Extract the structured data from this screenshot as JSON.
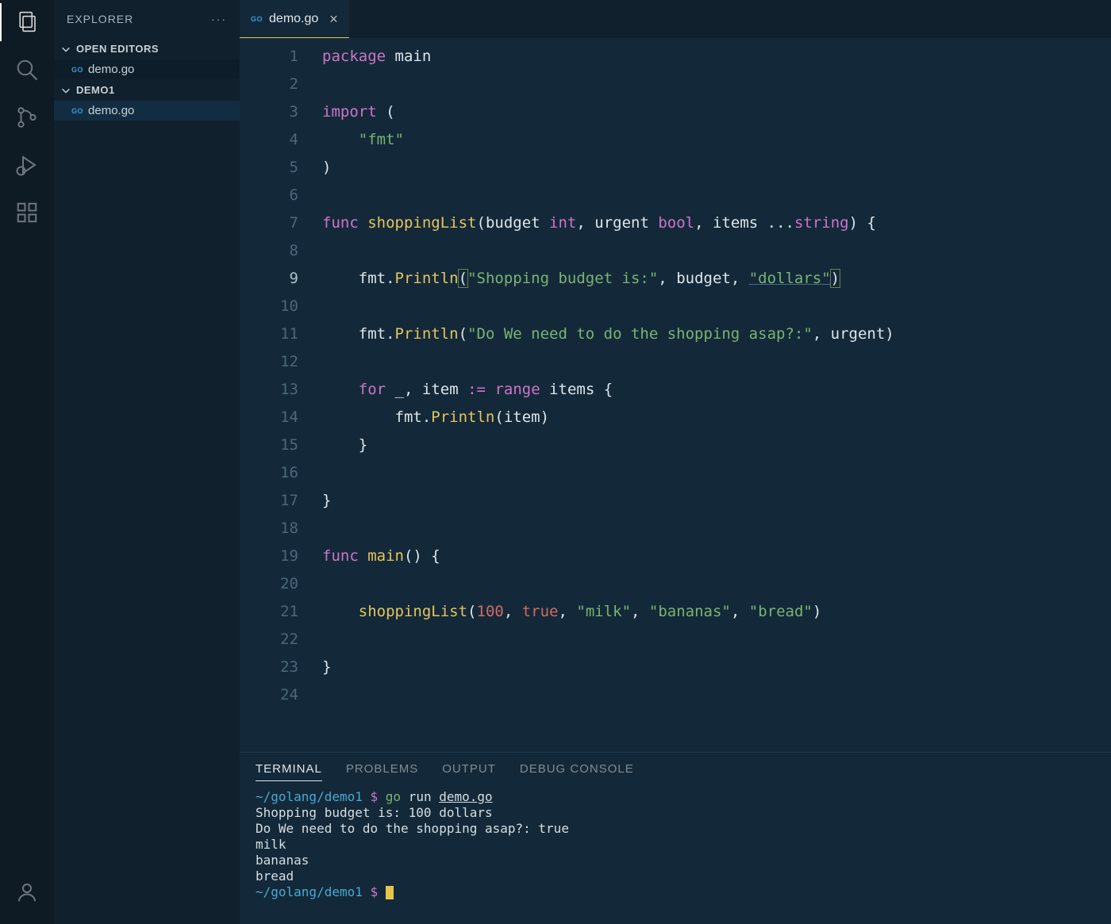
{
  "sidebar": {
    "title": "EXPLORER",
    "sections": {
      "open_editors_label": "OPEN EDITORS",
      "open_editors_file": "demo.go",
      "folder_label": "DEMO1",
      "folder_file": "demo.go"
    }
  },
  "tab": {
    "label": "demo.go"
  },
  "editor": {
    "lines": [
      1,
      2,
      3,
      4,
      5,
      6,
      7,
      8,
      9,
      10,
      11,
      12,
      13,
      14,
      15,
      16,
      17,
      18,
      19,
      20,
      21,
      22,
      23,
      24
    ],
    "active_line": 9
  },
  "code": {
    "l1_package": "package",
    "l1_main": "main",
    "l3_import": "import",
    "l4_fmt": "\"fmt\"",
    "l7_func": "func",
    "l7_name": "shoppingList",
    "l7_p1": "budget",
    "l7_t1": "int",
    "l7_p2": "urgent",
    "l7_t2": "bool",
    "l7_p3": "items",
    "l7_t3": "string",
    "l9_fmt": "fmt",
    "l9_println": "Println",
    "l9_s1": "\"Shopping budget is:\"",
    "l9_arg": "budget",
    "l9_s2": "\"dollars\"",
    "l11_fmt": "fmt",
    "l11_println": "Println",
    "l11_s1": "\"Do We need to do the shopping asap?:\"",
    "l11_arg": "urgent",
    "l13_for": "for",
    "l13_under": "_",
    "l13_item": "item",
    "l13_assign": ":=",
    "l13_range": "range",
    "l13_items": "items",
    "l14_fmt": "fmt",
    "l14_println": "Println",
    "l14_arg": "item",
    "l19_func": "func",
    "l19_main": "main",
    "l21_call": "shoppingList",
    "l21_n": "100",
    "l21_true": "true",
    "l21_s1": "\"milk\"",
    "l21_s2": "\"bananas\"",
    "l21_s3": "\"bread\""
  },
  "panel": {
    "tabs": {
      "terminal": "TERMINAL",
      "problems": "PROBLEMS",
      "output": "OUTPUT",
      "debug": "DEBUG CONSOLE"
    }
  },
  "terminal": {
    "prompt_path": "~/golang/demo1",
    "prompt_sym": "$",
    "cmd_go": "go",
    "cmd_run": "run",
    "cmd_file": "demo.go",
    "out1": "Shopping budget is: 100 dollars",
    "out2": "Do We need to do the shopping asap?: true",
    "out3": "milk",
    "out4": "bananas",
    "out5": "bread"
  }
}
